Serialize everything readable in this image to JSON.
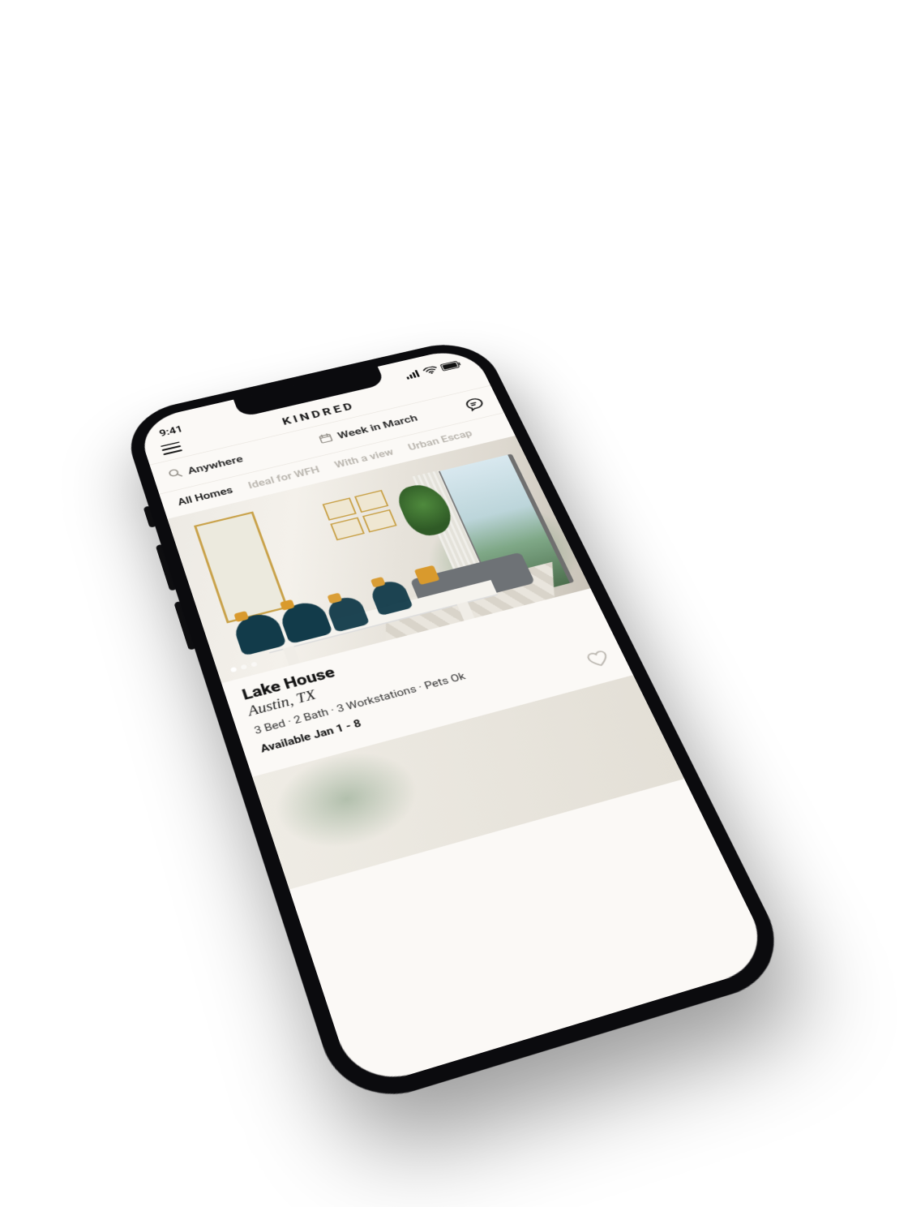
{
  "statusbar": {
    "time": "9:41"
  },
  "app": {
    "brand": "KINDRED"
  },
  "search": {
    "location": "Anywhere",
    "date": "Week in March"
  },
  "tabs": [
    {
      "label": "All Homes",
      "active": true
    },
    {
      "label": "Ideal for WFH",
      "active": false
    },
    {
      "label": "With a view",
      "active": false
    },
    {
      "label": "Urban Escap",
      "active": false
    }
  ],
  "listing": {
    "title": "Lake House",
    "location": "Austin, TX",
    "specs": "3 Bed · 2 Bath · 3 Workstations · Pets Ok",
    "availability": "Available Jan 1 - 8",
    "pager": {
      "count": 3,
      "active": 0
    }
  }
}
